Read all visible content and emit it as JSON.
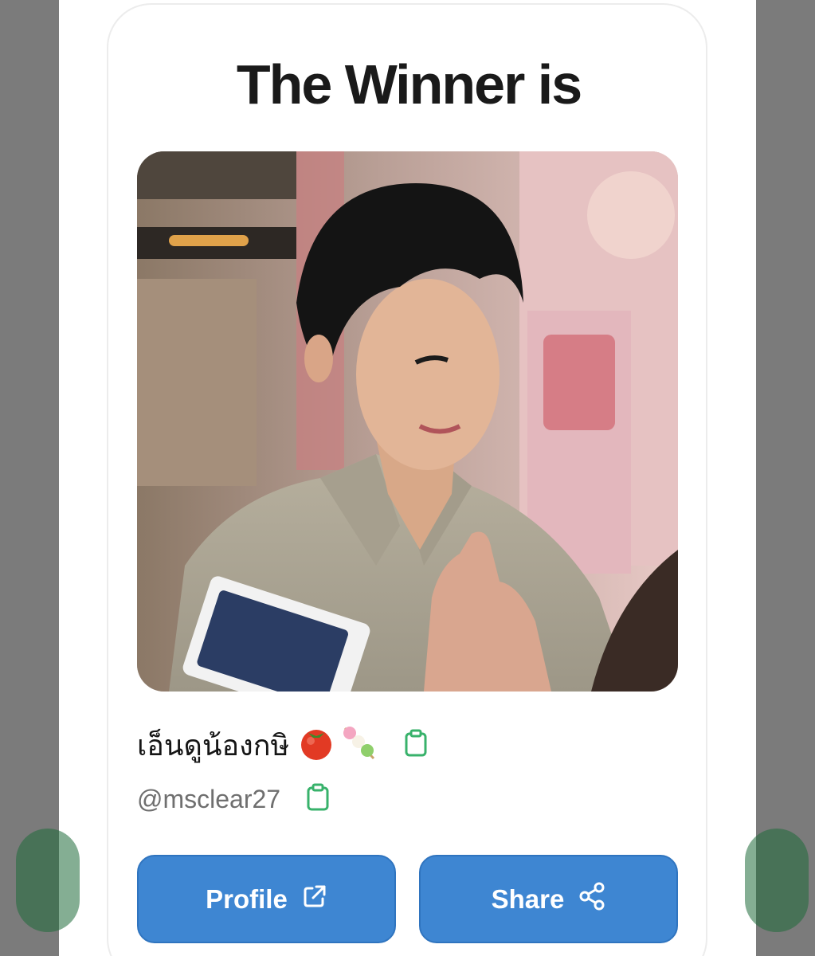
{
  "winner": {
    "title": "The Winner is",
    "display_name": "เอ็นดูน้องกษิ",
    "name_emojis": [
      "tomato-emoji",
      "dango-emoji"
    ],
    "handle": "@msclear27",
    "photo_alt": "winner-profile-photo"
  },
  "actions": {
    "profile_label": "Profile",
    "share_label": "Share"
  },
  "icons": {
    "copy": "clipboard-icon",
    "external": "external-link-icon",
    "share": "share-icon"
  },
  "colors": {
    "button": "#3e86d2",
    "copy_icon": "#38b26b",
    "title": "#1a1a1a",
    "handle": "#6f6f6f"
  }
}
